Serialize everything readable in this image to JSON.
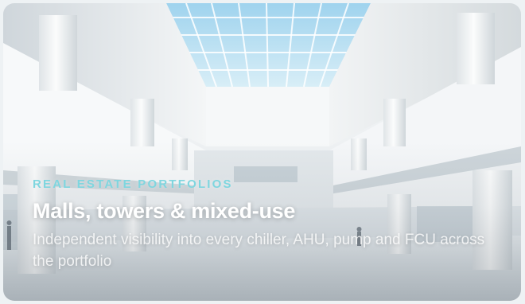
{
  "card": {
    "eyebrow": "REAL ESTATE PORTFOLIOS",
    "title": "Malls, towers & mixed-use",
    "description": "Independent visibility into every chiller, AHU, pump and FCU across the portfolio",
    "image_alt": "Bright white atrium interior with skylight ceiling and columns"
  },
  "colors": {
    "eyebrow": "#7fd6df",
    "title": "#ffffff",
    "description": "#f2f6f8"
  }
}
